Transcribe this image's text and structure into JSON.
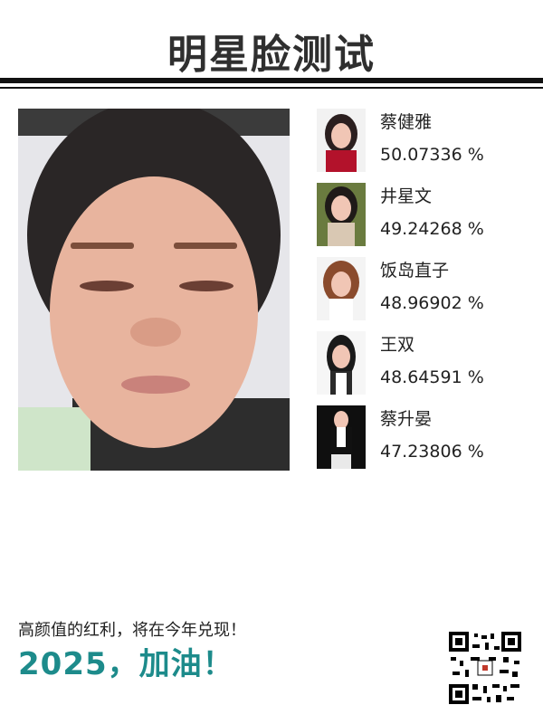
{
  "header": {
    "title": "明星脸测试"
  },
  "matches": [
    {
      "name": "蔡健雅",
      "score": "50.07336 %"
    },
    {
      "name": "井星文",
      "score": "49.24268 %"
    },
    {
      "name": "饭岛直子",
      "score": "48.96902 %"
    },
    {
      "name": "王双",
      "score": "48.64591 %"
    },
    {
      "name": "蔡升晏",
      "score": "47.23806 %"
    }
  ],
  "footer": {
    "line": "高颜值的红利，将在今年兑现！",
    "slogan": "2025，加油！"
  },
  "colors": {
    "accent": "#1d8b8b",
    "dark": "#2f2f2f"
  },
  "icons": {
    "qr": "qr-code-icon"
  }
}
